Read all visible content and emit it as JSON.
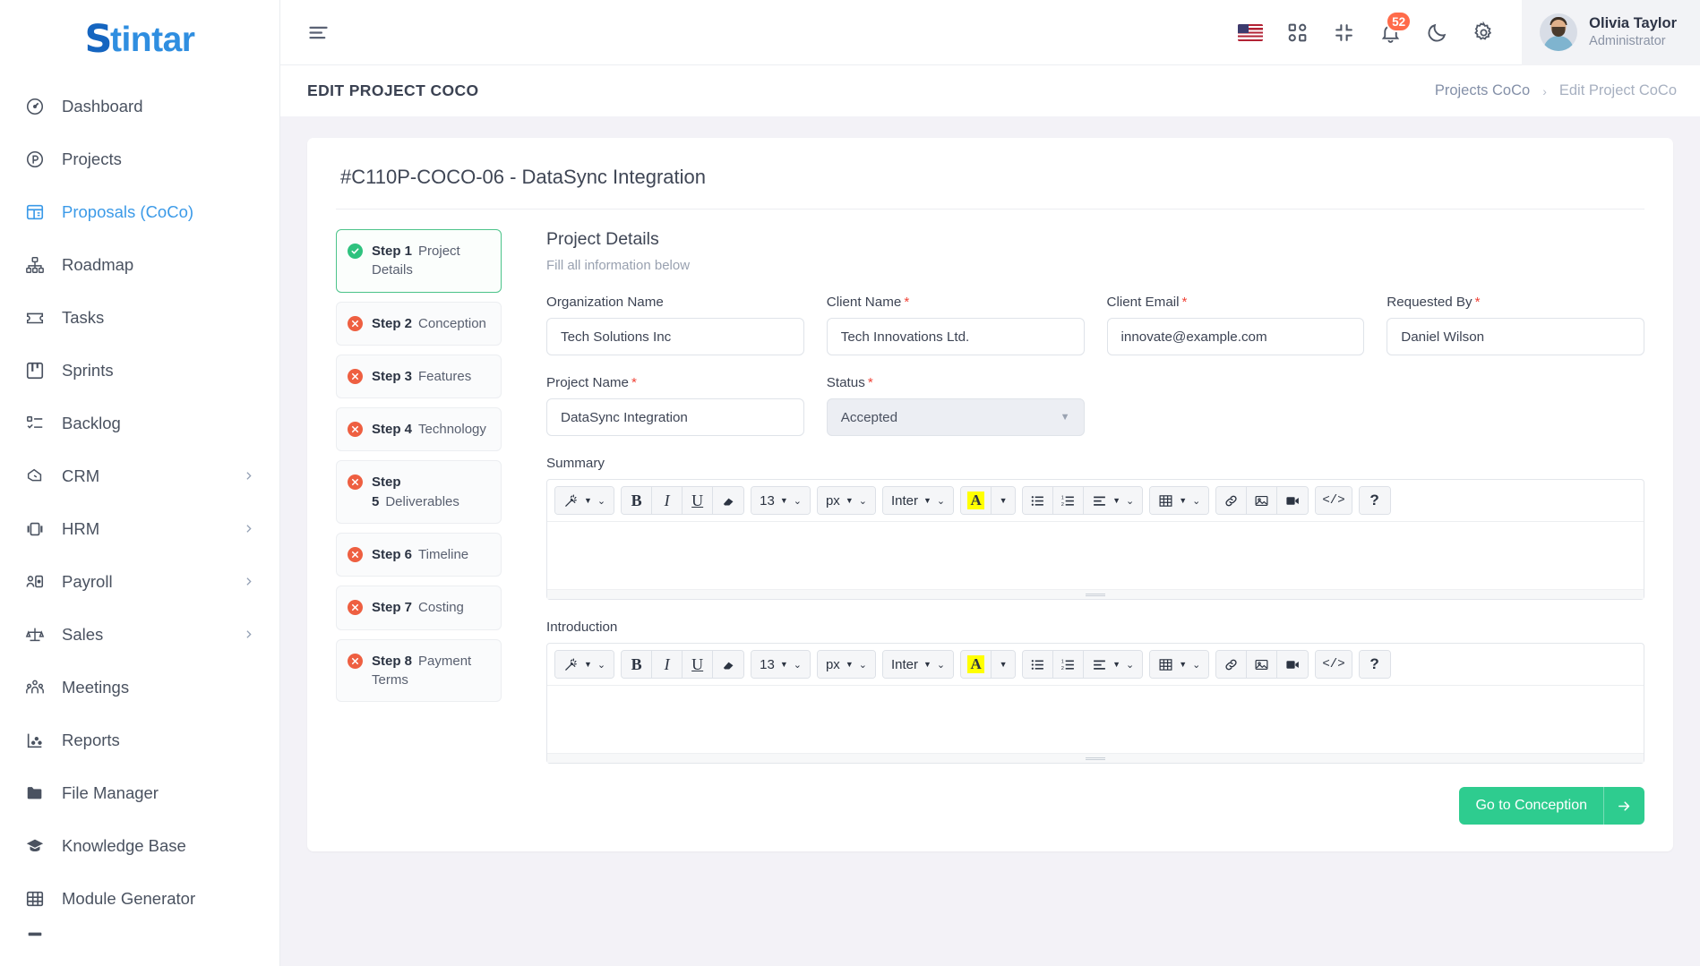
{
  "brand": {
    "logo_first": "S",
    "logo_rest": "tintar"
  },
  "sidebar": {
    "items": [
      {
        "label": "Dashboard",
        "icon": "speedometer-icon",
        "has_submenu": false
      },
      {
        "label": "Projects",
        "icon": "p-circle-icon",
        "has_submenu": false
      },
      {
        "label": "Proposals (CoCo)",
        "icon": "layout-panel-icon",
        "has_submenu": false,
        "active": true
      },
      {
        "label": "Roadmap",
        "icon": "sitemap-icon",
        "has_submenu": false
      },
      {
        "label": "Tasks",
        "icon": "ticket-icon",
        "has_submenu": false
      },
      {
        "label": "Sprints",
        "icon": "board-columns-icon",
        "has_submenu": false
      },
      {
        "label": "Backlog",
        "icon": "checklist-icon",
        "has_submenu": false
      },
      {
        "label": "CRM",
        "icon": "handshake-icon",
        "has_submenu": true
      },
      {
        "label": "HRM",
        "icon": "id-badge-icon",
        "has_submenu": true
      },
      {
        "label": "Payroll",
        "icon": "person-card-icon",
        "has_submenu": true
      },
      {
        "label": "Sales",
        "icon": "scales-icon",
        "has_submenu": true
      },
      {
        "label": "Meetings",
        "icon": "people-group-icon",
        "has_submenu": false
      },
      {
        "label": "Reports",
        "icon": "scatter-chart-icon",
        "has_submenu": false
      },
      {
        "label": "File Manager",
        "icon": "folder-icon",
        "has_submenu": false
      },
      {
        "label": "Knowledge Base",
        "icon": "graduation-cap-icon",
        "has_submenu": false
      },
      {
        "label": "Module Generator",
        "icon": "grid-table-icon",
        "has_submenu": false
      }
    ]
  },
  "topbar": {
    "menu_toggle": "hamburger-icon",
    "language_flag": "us-flag-icon",
    "apps_icon": "apps-grid-icon",
    "collapse_icon": "compress-icon",
    "notifications_icon": "bell-icon",
    "notifications_count": "52",
    "dark_mode_icon": "moon-icon",
    "settings_icon": "gear-icon",
    "user": {
      "name": "Olivia Taylor",
      "role": "Administrator"
    }
  },
  "pagehead": {
    "title": "EDIT PROJECT COCO",
    "breadcrumb": {
      "parent": "Projects CoCo",
      "separator": "›",
      "current": "Edit Project CoCo"
    }
  },
  "card": {
    "title": "#C110P-COCO-06 - DataSync Integration"
  },
  "steps": [
    {
      "n": "Step 1",
      "label": "Project Details",
      "state": "complete",
      "mark": "✓"
    },
    {
      "n": "Step 2",
      "label": "Conception",
      "state": "incomplete",
      "mark": "✕"
    },
    {
      "n": "Step 3",
      "label": "Features",
      "state": "incomplete",
      "mark": "✕"
    },
    {
      "n": "Step 4",
      "label": "Technology",
      "state": "incomplete",
      "mark": "✕"
    },
    {
      "n": "Step 5",
      "label": "Deliverables",
      "state": "incomplete",
      "mark": "✕"
    },
    {
      "n": "Step 6",
      "label": "Timeline",
      "state": "incomplete",
      "mark": "✕"
    },
    {
      "n": "Step 7",
      "label": "Costing",
      "state": "incomplete",
      "mark": "✕"
    },
    {
      "n": "Step 8",
      "label": "Payment Terms",
      "state": "incomplete",
      "mark": "✕"
    }
  ],
  "form": {
    "section_title": "Project Details",
    "section_sub": "Fill all information below",
    "row1": [
      {
        "label": "Organization Name",
        "required": false,
        "value": "Tech Solutions Inc"
      },
      {
        "label": "Client Name",
        "required": true,
        "value": "Tech Innovations Ltd."
      },
      {
        "label": "Client Email",
        "required": true,
        "value": "innovate@example.com"
      },
      {
        "label": "Requested By",
        "required": true,
        "value": "Daniel Wilson"
      }
    ],
    "row2": [
      {
        "label": "Project Name",
        "required": true,
        "value": "DataSync Integration"
      },
      {
        "label": "Status",
        "required": true,
        "value": "Accepted",
        "type": "select"
      }
    ],
    "summary_label": "Summary",
    "introduction_label": "Introduction",
    "summary_value": "",
    "introduction_value": ""
  },
  "editor_toolbar": {
    "font_size": "13",
    "unit": "px",
    "font_family": "Inter",
    "bold": "B",
    "italic": "I",
    "underline": "U",
    "code_label": "</>",
    "help_label": "?",
    "items": [
      "magic-wand-icon",
      "bold-icon",
      "italic-icon",
      "underline-icon",
      "eraser-icon",
      "font-size-dropdown",
      "unit-dropdown",
      "font-family-dropdown",
      "text-color-icon",
      "bullet-list-icon",
      "numbered-list-icon",
      "align-icon",
      "table-icon",
      "link-icon",
      "image-icon",
      "video-icon",
      "code-icon",
      "help-icon"
    ]
  },
  "footer": {
    "next_label": "Go to Conception",
    "next_icon": "arrow-right-icon"
  },
  "colors": {
    "accent_green": "#2ecc8f",
    "danger_red": "#ee5f41",
    "brand_blue": "#2f8ee0",
    "badge_orange": "#ff6b4a",
    "highlight_yellow": "#ffff00"
  }
}
